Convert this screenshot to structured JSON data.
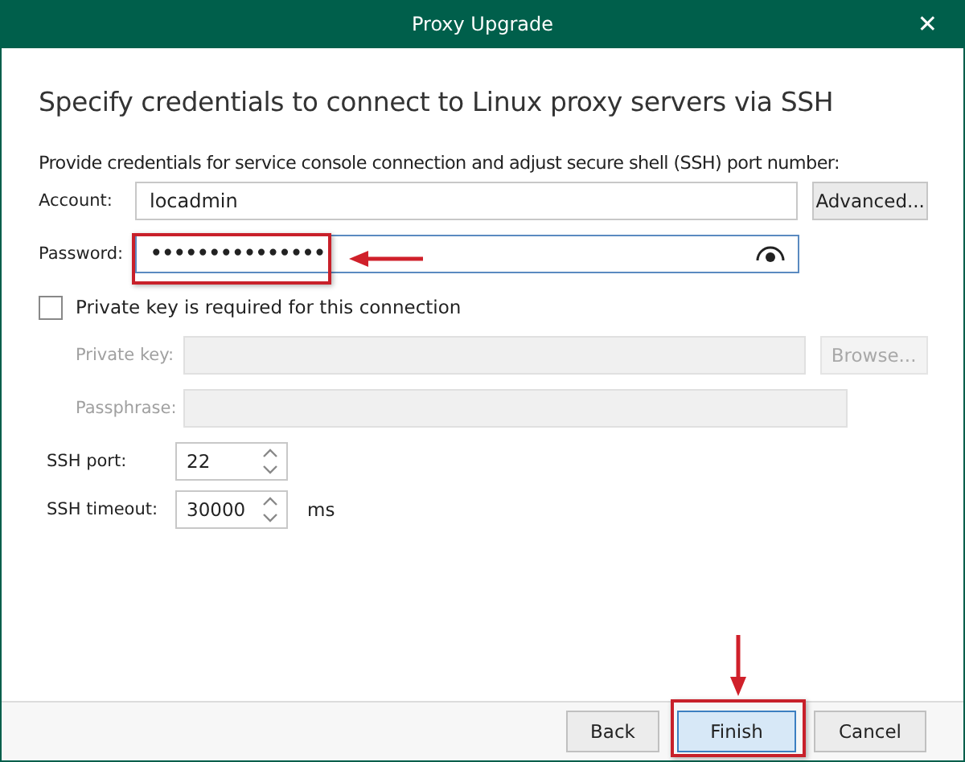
{
  "window": {
    "title": "Proxy Upgrade",
    "close": "✕"
  },
  "heading": "Specify credentials to connect to Linux proxy servers via SSH",
  "instruction": "Provide credentials for service console connection and adjust secure shell (SSH) port number:",
  "account": {
    "label": "Account:",
    "value": "locadmin",
    "button": {
      "label": "Advanced...",
      "disabled": false
    }
  },
  "password": {
    "label": "Password:",
    "value": "•••••••••••••••"
  },
  "private_key_required": {
    "label": "Private key is required for this connection",
    "checked": false
  },
  "private_key": {
    "label": "Private key:",
    "disabled": true,
    "button": {
      "label": "Browse...",
      "disabled": true
    }
  },
  "passphrase": {
    "label": "Passphrase:",
    "disabled": true
  },
  "ssh_port": {
    "label": "SSH port:",
    "value": "22"
  },
  "ssh_timeout": {
    "label": "SSH timeout:",
    "value": "30000",
    "unit": "ms"
  },
  "buttons": [
    {
      "label": "Back",
      "default": false
    },
    {
      "label": "Finish",
      "default": true
    },
    {
      "label": "Cancel",
      "default": false
    }
  ]
}
